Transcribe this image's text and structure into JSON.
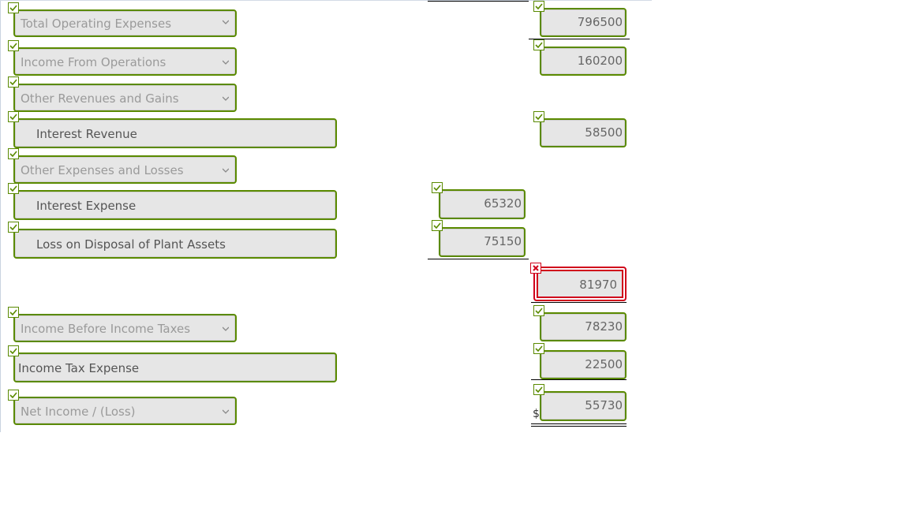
{
  "statement": {
    "rows": [
      {
        "label": "Total Operating Expenses",
        "type": "select",
        "status": "correct",
        "amount": "796500",
        "amount_column": "right",
        "amount_status": "correct"
      },
      {
        "label": "Income From Operations",
        "type": "select",
        "status": "correct",
        "amount": "160200",
        "amount_column": "right",
        "amount_status": "correct"
      },
      {
        "label": "Other Revenues and Gains",
        "type": "select",
        "status": "correct"
      },
      {
        "label": "Interest Revenue",
        "type": "text",
        "status": "correct",
        "amount": "58500",
        "amount_column": "right",
        "amount_status": "correct"
      },
      {
        "label": "Other Expenses and Losses",
        "type": "select",
        "status": "correct"
      },
      {
        "label": "Interest Expense",
        "type": "text",
        "status": "correct",
        "amount": "65320",
        "amount_column": "middle",
        "amount_status": "correct"
      },
      {
        "label": "Loss on Disposal of Plant Assets",
        "type": "text",
        "status": "correct",
        "amount": "75150",
        "amount_column": "middle",
        "amount_status": "correct"
      },
      {
        "label": "",
        "type": "none",
        "amount": "81970",
        "amount_column": "right",
        "amount_status": "incorrect"
      },
      {
        "label": "Income Before Income Taxes",
        "type": "select",
        "status": "correct",
        "amount": "78230",
        "amount_column": "right",
        "amount_status": "correct"
      },
      {
        "label": "Income Tax Expense",
        "type": "text",
        "status": "correct",
        "amount": "22500",
        "amount_column": "right",
        "amount_status": "correct"
      },
      {
        "label": "Net Income / (Loss)",
        "type": "select",
        "status": "correct",
        "amount": "55730",
        "amount_column": "right",
        "amount_status": "correct",
        "currency": "$"
      }
    ]
  },
  "colors": {
    "correct": "#5a8a00",
    "incorrect": "#d0021b",
    "field_bg": "#e6e6e6"
  }
}
